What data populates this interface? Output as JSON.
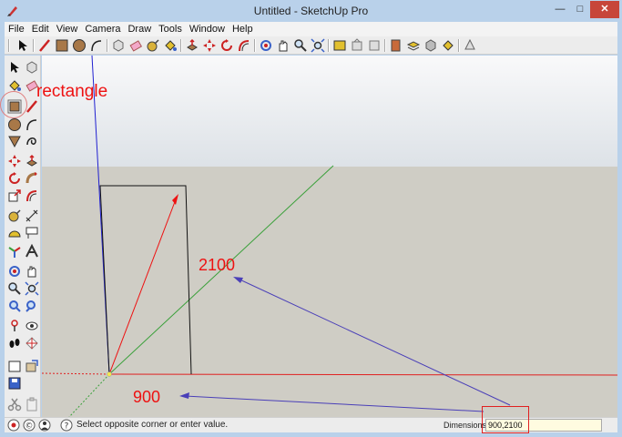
{
  "window": {
    "title": "Untitled - SketchUp Pro"
  },
  "menu": [
    "File",
    "Edit",
    "View",
    "Camera",
    "Draw",
    "Tools",
    "Window",
    "Help"
  ],
  "toolbar_icons": [
    "select-icon",
    "line-icon",
    "rectangle-icon",
    "circle-icon",
    "arc-icon",
    "make-component-icon",
    "eraser-icon",
    "tape-measure-icon",
    "paint-bucket-icon",
    "push-pull-icon",
    "move-icon",
    "rotate-icon",
    "offset-icon",
    "orbit-icon",
    "pan-icon",
    "zoom-icon",
    "zoom-extents-icon",
    "warehouse-icon",
    "share-model-icon",
    "extension-icon",
    "styles-icon",
    "layers-icon",
    "components-icon",
    "materials-icon"
  ],
  "status": {
    "hint": "Select opposite corner or enter value.",
    "dimensions_label": "Dimensions",
    "dimensions_value": "900,2100"
  },
  "annotations": {
    "tool_label": "rectangle",
    "height_label": "2100",
    "width_label": "900"
  },
  "colors": {
    "red_axis": "#e02020",
    "green_axis": "#3aa03a",
    "blue_axis": "#2020d0",
    "annotation": "#ee1111",
    "sky": "#e9edf2",
    "ground": "#cfcdc5"
  }
}
